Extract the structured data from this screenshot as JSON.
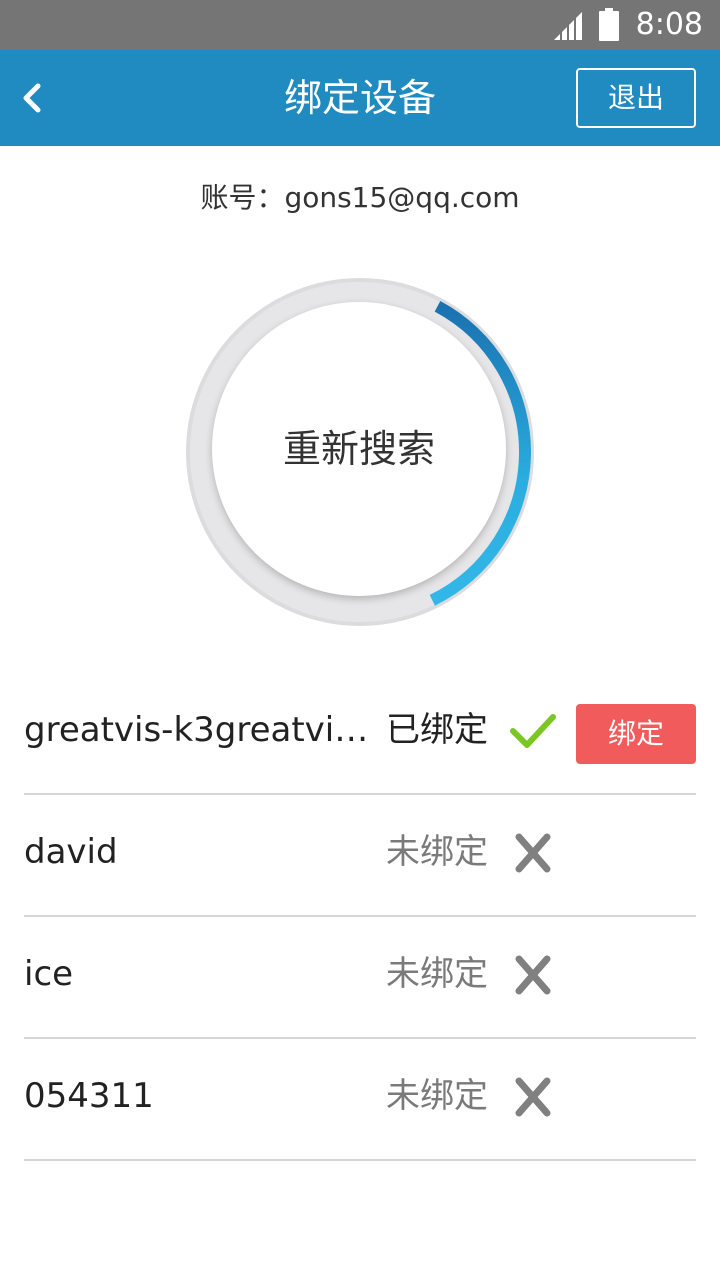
{
  "status_bar": {
    "time": "8:08",
    "signal_icon": "signal-icon",
    "battery_icon": "battery-icon"
  },
  "header": {
    "title": "绑定设备",
    "back_icon": "chevron-left-icon",
    "logout_label": "退出",
    "background": "#1f8bc0"
  },
  "account": {
    "label": "账号：gons15@qq.com"
  },
  "search": {
    "button_label": "重新搜索",
    "progress": 0.35,
    "accent": "#1f8bc0"
  },
  "devices": [
    {
      "name": "greatvis-k3greatvis...",
      "status": "已绑定",
      "bound": true,
      "icon": "check-icon",
      "action_label": "绑定"
    },
    {
      "name": "david",
      "status": "未绑定",
      "bound": false,
      "icon": "cross-icon"
    },
    {
      "name": "ice",
      "status": "未绑定",
      "bound": false,
      "icon": "cross-icon"
    },
    {
      "name": "054311",
      "status": "未绑定",
      "bound": false,
      "icon": "cross-icon"
    }
  ],
  "colors": {
    "bound_check": "#7cc624",
    "unbound_cross": "#808080",
    "bind_button": "#f25b5b"
  }
}
